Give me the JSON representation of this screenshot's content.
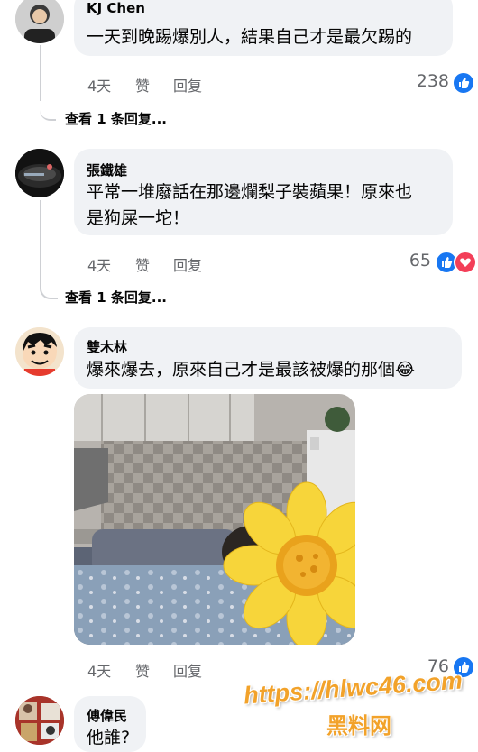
{
  "comments": [
    {
      "author": "KJ Chen",
      "text": "一天到晚踢爆別人，結果自己才是最欠踢的",
      "time": "4天",
      "like_label": "赞",
      "reply_label": "回复",
      "reaction_count": "238",
      "reactions": [
        "like"
      ],
      "view_replies": "查看 1 条回复..."
    },
    {
      "author": "張鐵雄",
      "text_line1": "平常一堆廢話在那邊爛梨子裝蘋果！原來也",
      "text_line2": "是狗屎一坨！",
      "time": "4天",
      "like_label": "赞",
      "reply_label": "回复",
      "reaction_count": "65",
      "reactions": [
        "like",
        "love"
      ],
      "view_replies": "查看 1 条回复..."
    },
    {
      "author": "雙木林",
      "text": "爆來爆去，原來自己才是最該被爆的那個",
      "emoji": "😂",
      "time": "4天",
      "like_label": "赞",
      "reply_label": "回复",
      "reaction_count": "76",
      "reactions": [
        "like"
      ]
    },
    {
      "author": "傅偉民",
      "text": "他誰?"
    }
  ],
  "watermark": {
    "url": "https://hlwc46.com",
    "site": "黑料网"
  },
  "colors": {
    "bubble": "#f0f2f5",
    "like_blue": "#1877f2",
    "love_red": "#f33e58",
    "meta_gray": "#65676b",
    "watermark": "#f2a22a"
  }
}
